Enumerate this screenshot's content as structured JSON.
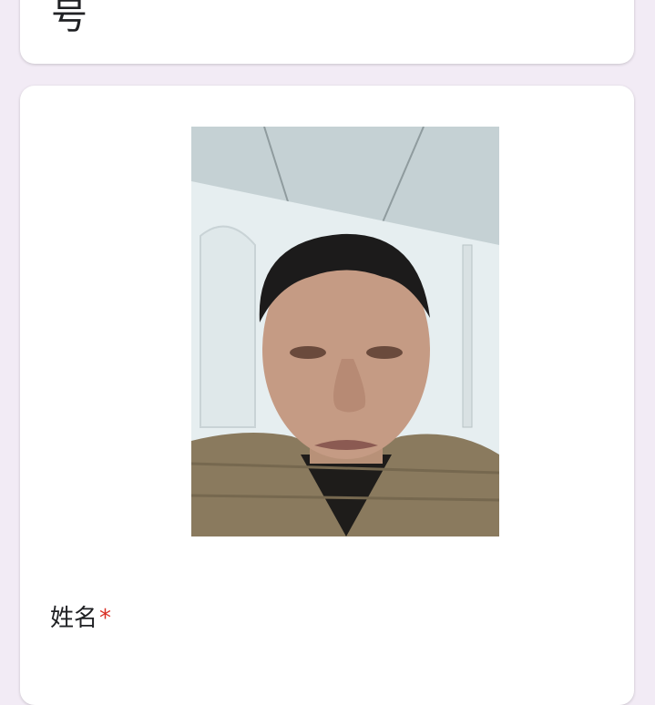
{
  "header_card": {
    "title_partial": "号"
  },
  "question": {
    "label": "姓名",
    "required_mark": "*"
  },
  "colors": {
    "page_background": "#f2ebf5",
    "card_background": "#ffffff",
    "required": "#d93025"
  }
}
